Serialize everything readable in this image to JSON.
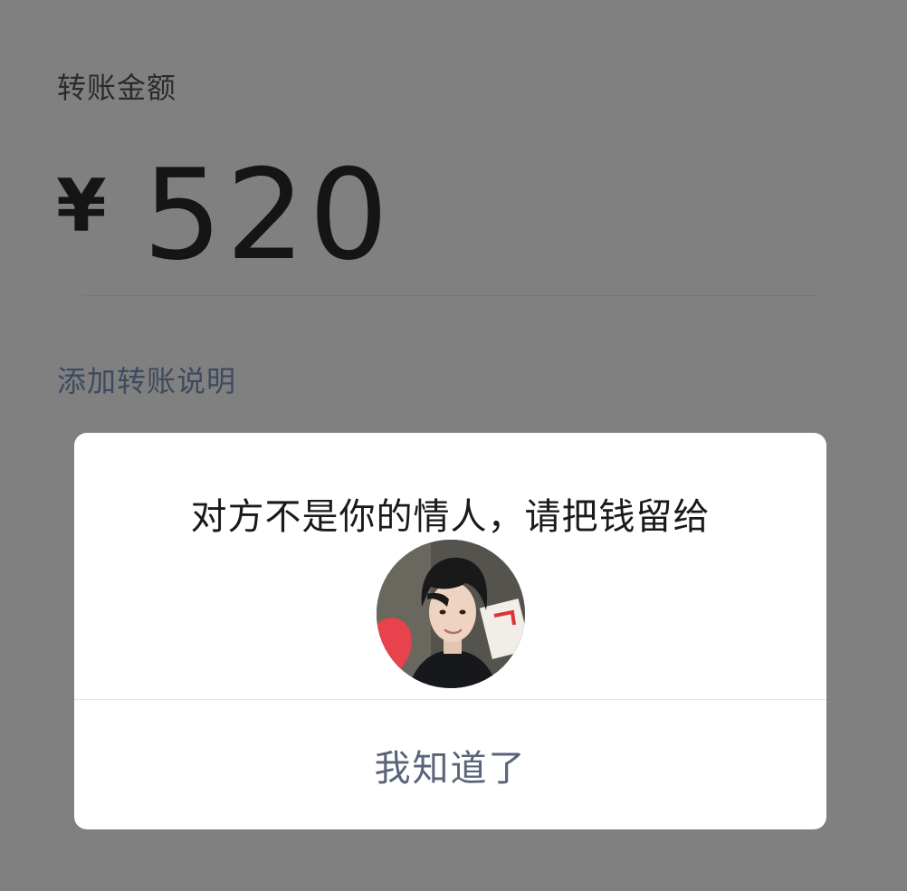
{
  "transfer": {
    "amount_label": "转账金额",
    "currency_symbol": "¥",
    "amount": "520",
    "add_note_link": "添加转账说明"
  },
  "dialog": {
    "message": "对方不是你的情人，请把钱留给",
    "avatar_icon": "person-photo-icon",
    "confirm_button": "我知道了"
  },
  "colors": {
    "overlay": "#808080",
    "dialog_bg": "#ffffff",
    "link_text": "#3e4a5e",
    "button_text": "#5a6478"
  }
}
